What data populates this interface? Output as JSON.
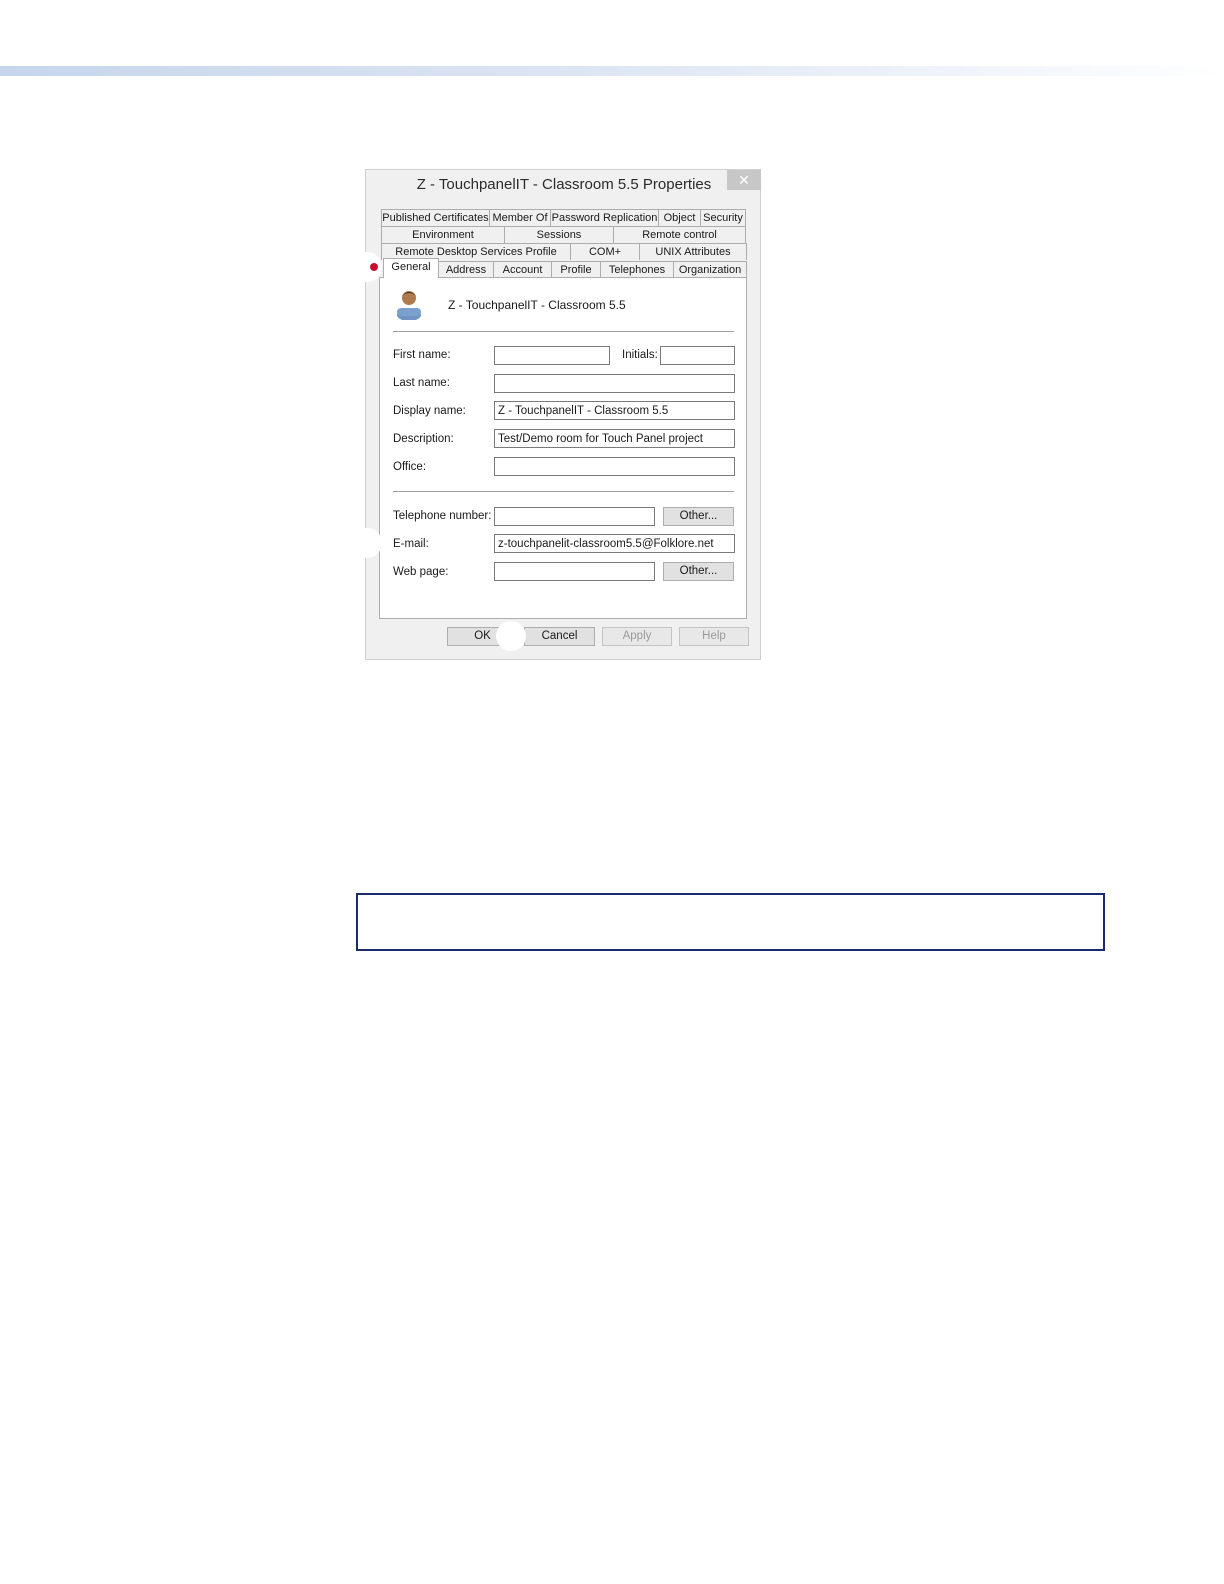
{
  "dialog": {
    "title": "Z - TouchpanelIT - Classroom 5.5 Properties",
    "close_glyph": "✕",
    "tab_rows": [
      [
        "Published Certificates",
        "Member Of",
        "Password Replication",
        "Object",
        "Security"
      ],
      [
        "Environment",
        "Sessions",
        "Remote control"
      ],
      [
        "Remote Desktop Services Profile",
        "COM+",
        "UNIX Attributes"
      ],
      [
        "General",
        "Address",
        "Account",
        "Profile",
        "Telephones",
        "Organization"
      ]
    ],
    "active_tab": "General",
    "object_icon": "user-icon",
    "object_name": "Z - TouchpanelIT - Classroom 5.5",
    "fields": {
      "first_name_label": "First name:",
      "first_name_value": "",
      "initials_label": "Initials:",
      "initials_value": "",
      "last_name_label": "Last name:",
      "last_name_value": "",
      "display_name_label": "Display name:",
      "display_name_value": "Z - TouchpanelIT - Classroom 5.5",
      "description_label": "Description:",
      "description_value": "Test/Demo room for Touch Panel project",
      "office_label": "Office:",
      "office_value": "",
      "telephone_label": "Telephone number:",
      "telephone_value": "",
      "email_label": "E-mail:",
      "email_value": "z-touchpanelit-classroom5.5@Folklore.net",
      "webpage_label": "Web page:",
      "webpage_value": ""
    },
    "buttons": {
      "other_telephone": "Other...",
      "other_webpage": "Other...",
      "ok": "OK",
      "cancel": "Cancel",
      "apply": "Apply",
      "help": "Help"
    }
  },
  "colors": {
    "accent_band": "#c7d6ec",
    "note_border": "#1b2a6b",
    "marker_red": "#c8102e"
  }
}
